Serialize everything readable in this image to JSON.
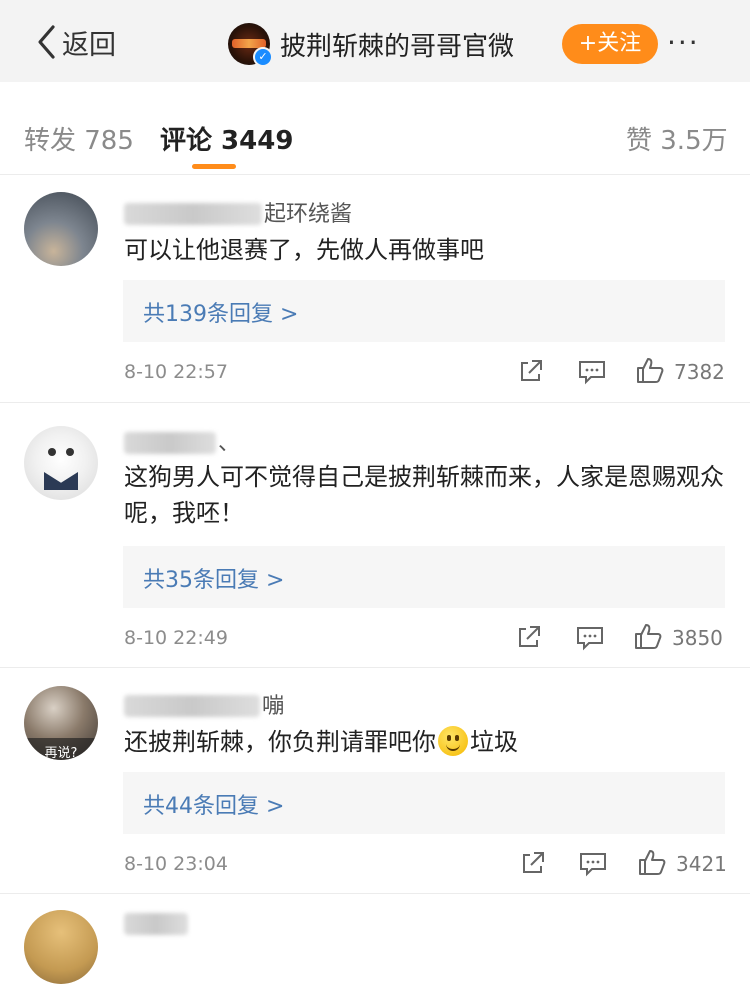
{
  "nav": {
    "back_label": "返回",
    "title": "披荆斩棘的哥哥官微",
    "follow_label": "+关注",
    "more_label": "···"
  },
  "tabs": {
    "repost": "转发 785",
    "comments": "评论 3449",
    "likes": "赞 3.5万"
  },
  "comments": [
    {
      "username_visible": "起环绕酱",
      "text": "可以让他退赛了，先做人再做事吧",
      "replies_label": "共139条回复 >",
      "time": "8-10 22:57",
      "likes": "7382",
      "avatar_caption": ""
    },
    {
      "username_visible": "、",
      "text": "这狗男人可不觉得自己是披荆斩棘而来，人家是恩赐观众呢，我呸！",
      "replies_label": "共35条回复 >",
      "time": "8-10 22:49",
      "likes": "3850",
      "avatar_caption": ""
    },
    {
      "username_visible": "嘣",
      "text_before_emoji": "还披荆斩棘，你负荆请罪吧你",
      "text_after_emoji": "垃圾",
      "emoji": "smile-emoji",
      "replies_label": "共44条回复 >",
      "time": "8-10 23:04",
      "likes": "3421",
      "avatar_caption": "再说?"
    }
  ],
  "colors": {
    "accent": "#ff8c1a",
    "link": "#4a7bb5",
    "verified": "#1a8cff"
  }
}
